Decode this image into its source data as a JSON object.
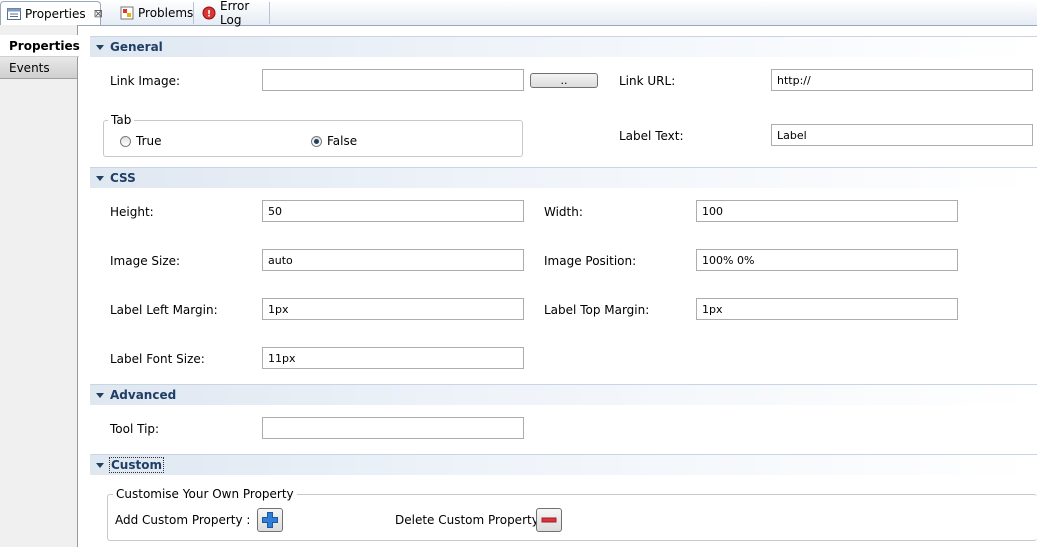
{
  "tabs": [
    {
      "label": "Properties",
      "icon": "properties-icon",
      "active": true
    },
    {
      "label": "Problems",
      "icon": "problems-icon",
      "active": false
    },
    {
      "label": "Error Log",
      "icon": "error-log-icon",
      "active": false
    }
  ],
  "nav": {
    "items": [
      {
        "label": "Properties",
        "selected": true
      },
      {
        "label": "Events",
        "selected": false
      }
    ]
  },
  "sections": {
    "general": "General",
    "css": "CSS",
    "advanced": "Advanced",
    "custom": "Custom"
  },
  "general": {
    "link_image_label": "Link Image:",
    "link_image_value": "",
    "browse_label": "..",
    "link_url_label": "Link URL:",
    "link_url_value": "http://",
    "tab_group_label": "Tab",
    "tab_true_label": "True",
    "tab_false_label": "False",
    "tab_selected": "False",
    "label_text_label": "Label Text:",
    "label_text_value": "Label"
  },
  "css": {
    "height_label": "Height:",
    "height_value": "50",
    "width_label": "Width:",
    "width_value": "100",
    "image_size_label": "Image Size:",
    "image_size_value": "auto",
    "image_position_label": "Image Position:",
    "image_position_value": "100% 0%",
    "label_left_margin_label": "Label Left Margin:",
    "label_left_margin_value": "1px",
    "label_top_margin_label": "Label Top Margin:",
    "label_top_margin_value": "1px",
    "label_font_size_label": "Label Font Size:",
    "label_font_size_value": "11px"
  },
  "advanced": {
    "tool_tip_label": "Tool Tip:",
    "tool_tip_value": ""
  },
  "custom": {
    "group_label": "Customise Your Own Property",
    "add_label": "Add Custom Property :",
    "delete_label": "Delete Custom Property :"
  },
  "colors": {
    "section_title": "#1f3e66",
    "add_icon": "#2f7fd6",
    "delete_icon": "#d9363e"
  }
}
